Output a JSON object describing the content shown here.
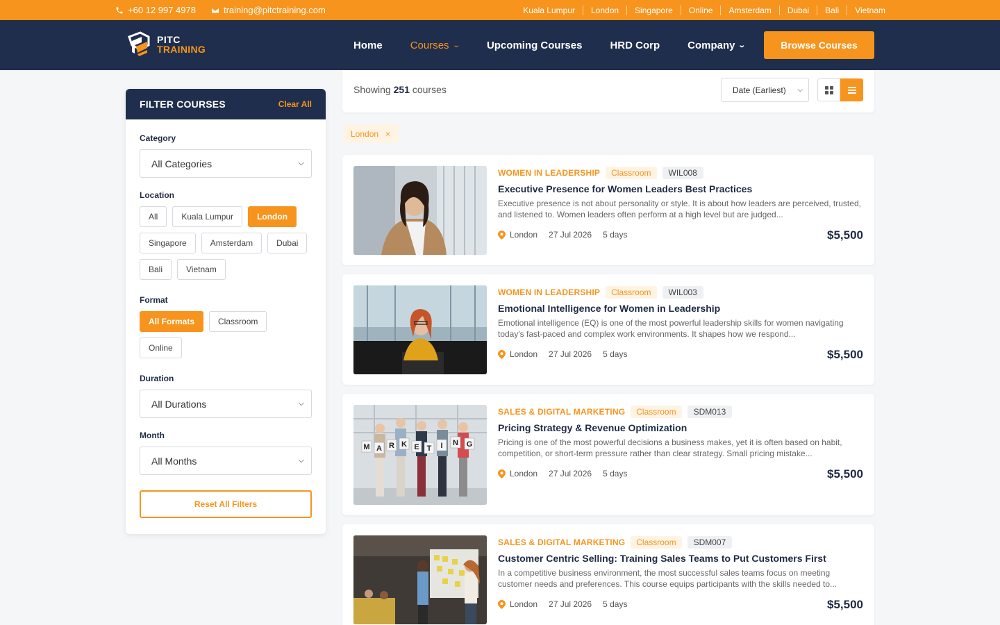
{
  "topbar": {
    "phone": "+60 12 997 4978",
    "email": "training@pitctraining.com",
    "cities": [
      "Kuala Lumpur",
      "London",
      "Singapore",
      "Online",
      "Amsterdam",
      "Dubai",
      "Bali",
      "Vietnam"
    ]
  },
  "brand": {
    "line1": "PITC",
    "line2": "TRAINING"
  },
  "nav": {
    "home": "Home",
    "courses": "Courses",
    "upcoming": "Upcoming Courses",
    "hrd": "HRD Corp",
    "company": "Company",
    "cta": "Browse Courses"
  },
  "filters": {
    "title": "FILTER COURSES",
    "clear": "Clear All",
    "category_label": "Category",
    "category_value": "All Categories",
    "location_label": "Location",
    "locations": [
      "All",
      "Kuala Lumpur",
      "London",
      "Singapore",
      "Amsterdam",
      "Dubai",
      "Bali",
      "Vietnam"
    ],
    "location_selected": "London",
    "format_label": "Format",
    "formats": [
      "All Formats",
      "Classroom",
      "Online"
    ],
    "format_selected": "All Formats",
    "duration_label": "Duration",
    "duration_value": "All Durations",
    "month_label": "Month",
    "month_value": "All Months",
    "reset": "Reset All Filters"
  },
  "results": {
    "showing_prefix": "Showing",
    "count": "251",
    "showing_suffix": "courses",
    "sort": "Date (Earliest)",
    "active_filter": "London",
    "remove_symbol": "×"
  },
  "courses": [
    {
      "category": "WOMEN IN LEADERSHIP",
      "format": "Classroom",
      "code": "WIL008",
      "title": "Executive Presence for Women Leaders Best Practices",
      "desc": "Executive presence is not about personality or style. It is about how leaders are perceived, trusted, and listened to. Women leaders often perform at a high level but are judged...",
      "location": "London",
      "date": "27 Jul 2026",
      "duration": "5 days",
      "price": "$5,500"
    },
    {
      "category": "WOMEN IN LEADERSHIP",
      "format": "Classroom",
      "code": "WIL003",
      "title": "Emotional Intelligence for Women in Leadership",
      "desc": "Emotional intelligence (EQ) is one of the most powerful leadership skills for women navigating today's fast-paced and complex work environments. It shapes how we respond...",
      "location": "London",
      "date": "27 Jul 2026",
      "duration": "5 days",
      "price": "$5,500"
    },
    {
      "category": "SALES & DIGITAL MARKETING",
      "format": "Classroom",
      "code": "SDM013",
      "title": "Pricing Strategy & Revenue Optimization",
      "desc": "Pricing is one of the most powerful decisions a business makes, yet it is often based on habit, competition, or short-term pressure rather than clear strategy. Small pricing mistake...",
      "location": "London",
      "date": "27 Jul 2026",
      "duration": "5 days",
      "price": "$5,500",
      "image_text": [
        "M",
        "A",
        "R",
        "K",
        "E",
        "T",
        "I",
        "N",
        "G"
      ]
    },
    {
      "category": "SALES & DIGITAL MARKETING",
      "format": "Classroom",
      "code": "SDM007",
      "title": "Customer Centric Selling: Training Sales Teams to Put Customers First",
      "desc": "In a competitive business environment, the most successful sales teams focus on meeting customer needs and preferences. This course equips participants with the skills needed to...",
      "location": "London",
      "date": "27 Jul 2026",
      "duration": "5 days",
      "price": "$5,500"
    }
  ],
  "colors": {
    "accent": "#f7941d",
    "navy": "#1f2e4c"
  }
}
